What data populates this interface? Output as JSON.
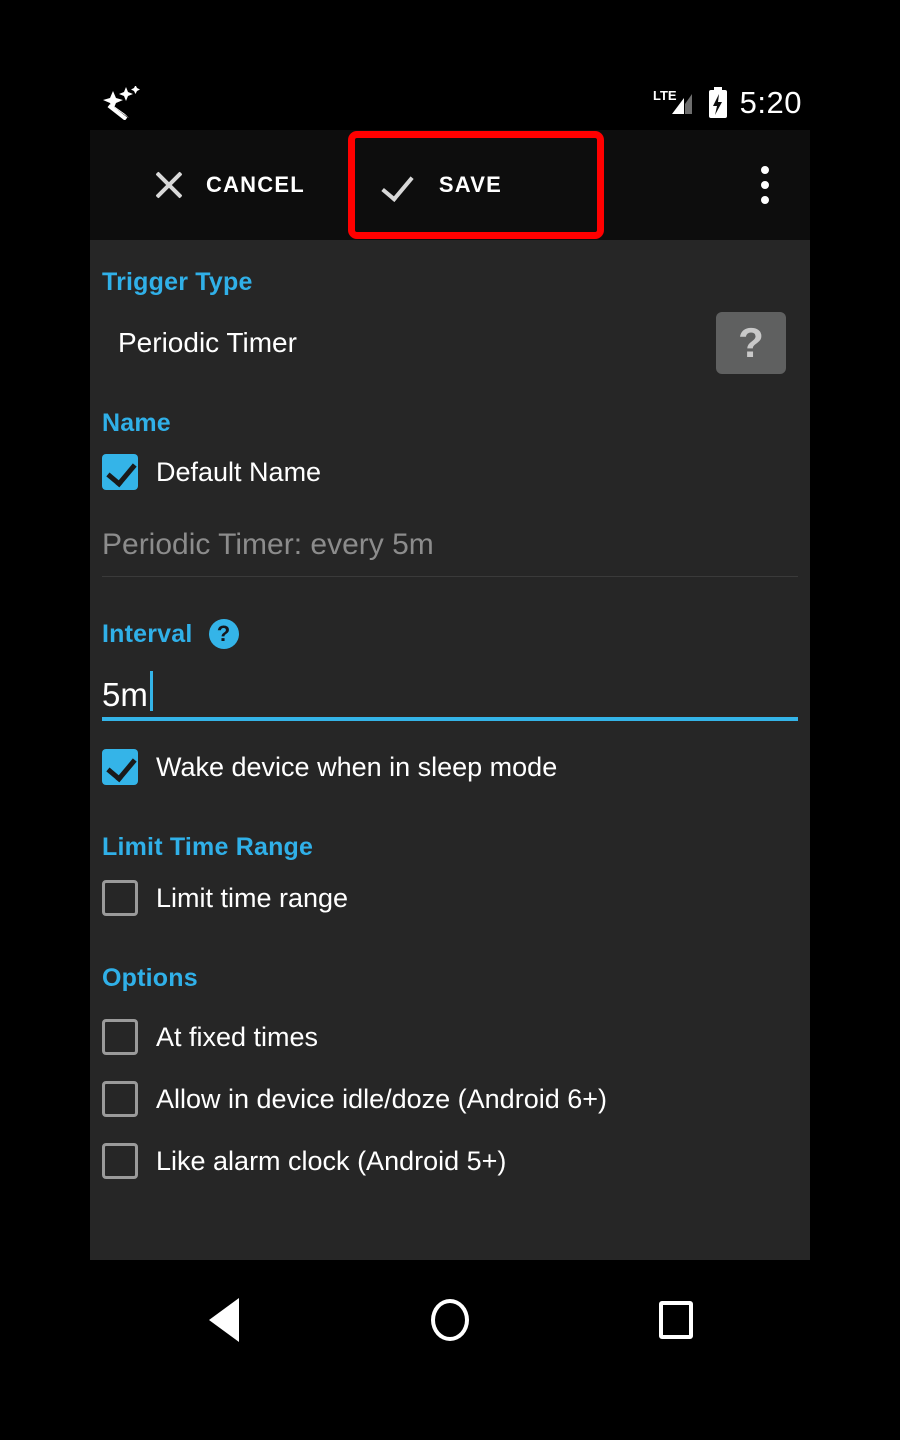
{
  "status_bar": {
    "notification_icon": "magic-wand-icon",
    "network_label": "LTE",
    "signal_icon": "signal-bars-icon",
    "battery_icon": "battery-charging-icon",
    "time": "5:20"
  },
  "toolbar": {
    "cancel_icon": "close-x-icon",
    "cancel_label": "CANCEL",
    "save_icon": "checkmark-icon",
    "save_label": "SAVE",
    "overflow_icon": "more-vertical-icon",
    "highlight_color": "#ff0000",
    "highlight_target": "SAVE"
  },
  "content": {
    "trigger_type": {
      "section_label": "Trigger Type",
      "value": "Periodic Timer",
      "help_icon": "question-mark-icon",
      "help_glyph": "?"
    },
    "name": {
      "section_label": "Name",
      "default_name_label": "Default Name",
      "default_name_checked": true,
      "placeholder": "Periodic Timer: every 5m"
    },
    "interval": {
      "section_label": "Interval",
      "help_icon": "question-circle-icon",
      "help_glyph": "?",
      "value": "5m",
      "wake_label": "Wake device when in sleep mode",
      "wake_checked": true
    },
    "limit_time_range": {
      "section_label": "Limit Time Range",
      "items": [
        {
          "label": "Limit time range",
          "checked": false
        }
      ]
    },
    "options": {
      "section_label": "Options",
      "items": [
        {
          "label": "At fixed times",
          "checked": false
        },
        {
          "label": "Allow in device idle/doze (Android 6+)",
          "checked": false
        },
        {
          "label": "Like alarm clock (Android 5+)",
          "checked": false
        }
      ]
    }
  },
  "nav_bar": {
    "back_icon": "triangle-back-icon",
    "home_icon": "circle-home-icon",
    "recents_icon": "square-recents-icon"
  },
  "colors": {
    "accent": "#30b0e8",
    "checkbox_on": "#34b4e8",
    "panel_bg": "#262626",
    "toolbar_bg": "#0d0d0d",
    "highlight": "#ff0000"
  }
}
